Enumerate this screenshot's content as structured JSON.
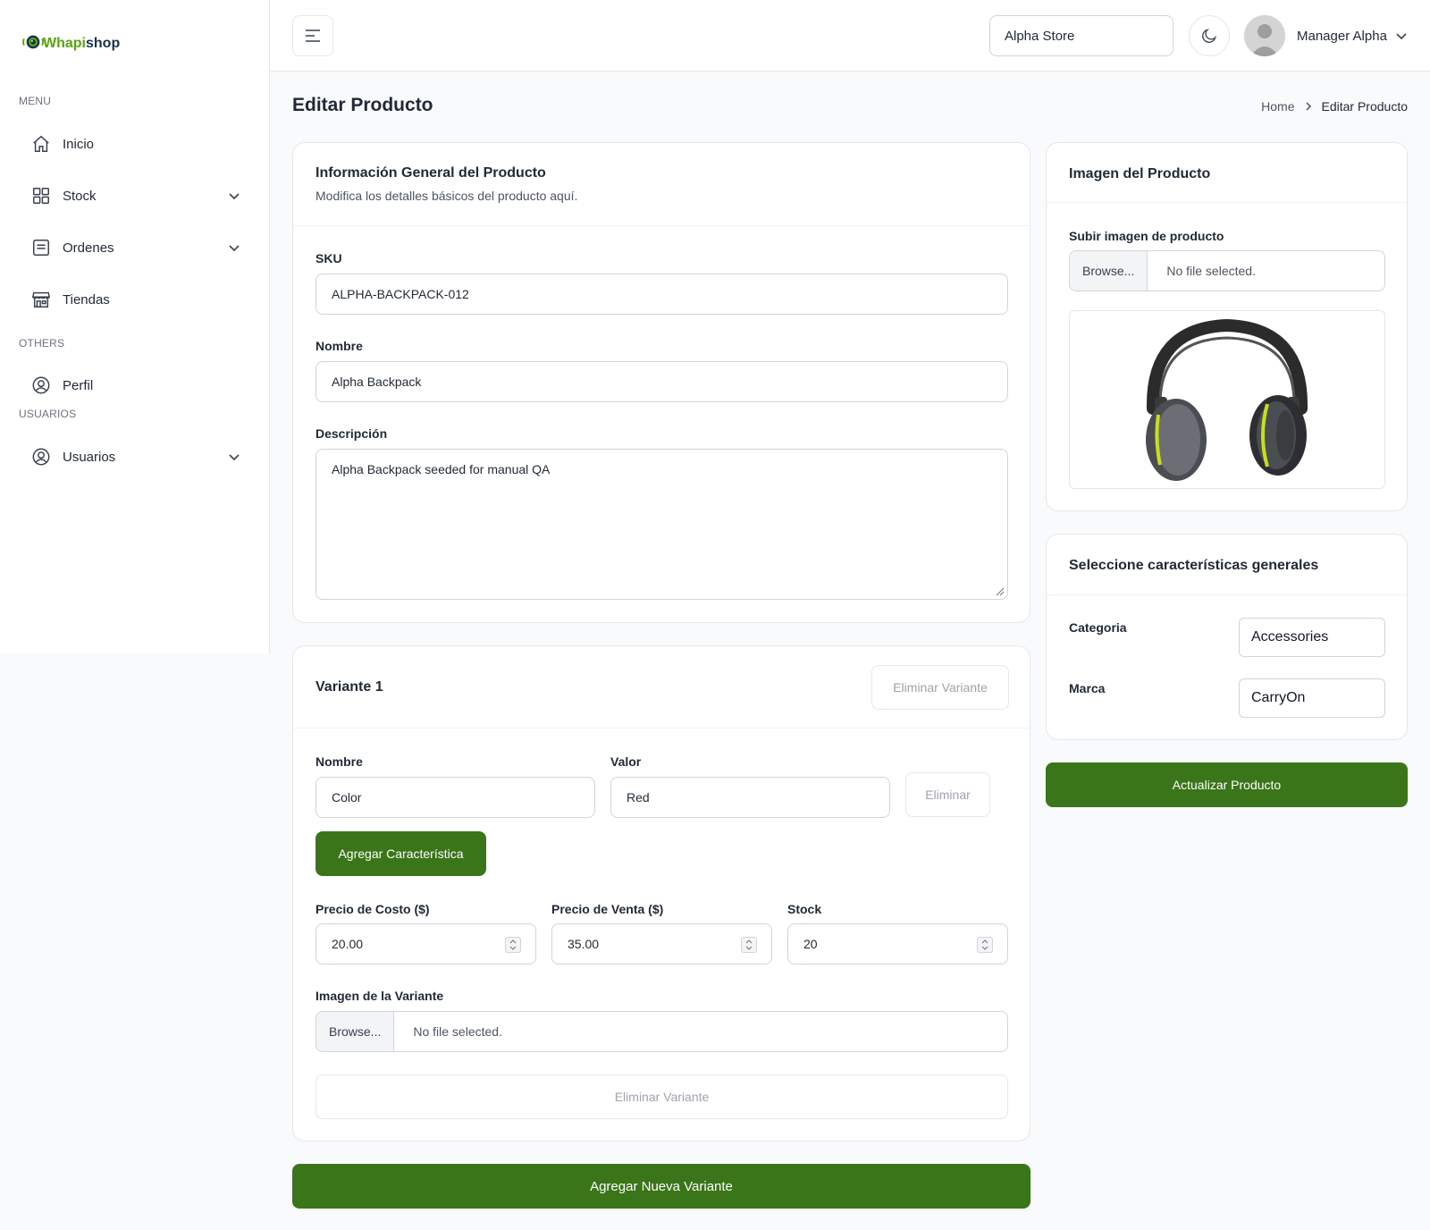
{
  "brand": {
    "logo_text_green": "Whapi",
    "logo_text_dark": "shop"
  },
  "sidebar": {
    "groups": {
      "menu": "MENU",
      "others": "OTHERS",
      "usuarios": "USUARIOS"
    },
    "items": [
      {
        "label": "Inicio",
        "icon": "home-icon"
      },
      {
        "label": "Stock",
        "icon": "grid-icon"
      },
      {
        "label": "Ordenes",
        "icon": "list-icon"
      },
      {
        "label": "Tiendas",
        "icon": "store-icon"
      },
      {
        "label": "Perfil",
        "icon": "user-circle-icon"
      },
      {
        "label": "Usuarios",
        "icon": "user-circle-icon"
      }
    ]
  },
  "header": {
    "store": "Alpha Store",
    "user_name": "Manager Alpha"
  },
  "page": {
    "title": "Editar Producto"
  },
  "breadcrumb": {
    "home": "Home",
    "current": "Editar Producto"
  },
  "general_info": {
    "title": "Información General del Producto",
    "subtitle": "Modifica los detalles básicos del producto aquí.",
    "sku_label": "SKU",
    "sku_value": "ALPHA-BACKPACK-012",
    "name_label": "Nombre",
    "name_value": "Alpha Backpack",
    "desc_label": "Descripción",
    "desc_value": "Alpha Backpack seeded for manual QA"
  },
  "variant": {
    "title": "Variante 1",
    "remove_top": "Eliminar Variante",
    "attr_name_label": "Nombre",
    "attr_value_label": "Valor",
    "attr_name": "Color",
    "attr_value": "Red",
    "attr_remove": "Eliminar",
    "add_attr": "Agregar Característica",
    "cost_label": "Precio de Costo ($)",
    "cost_value": "20.00",
    "sale_label": "Precio de Venta ($)",
    "sale_value": "35.00",
    "stock_label": "Stock",
    "stock_value": "20",
    "image_label": "Imagen de la Variante",
    "browse": "Browse...",
    "no_file": "No file selected.",
    "remove_bottom": "Eliminar Variante"
  },
  "add_variant": "Agregar Nueva Variante",
  "image_card": {
    "title": "Imagen del Producto",
    "upload_label": "Subir imagen de producto",
    "browse": "Browse...",
    "no_file": "No file selected."
  },
  "features": {
    "title": "Seleccione características generales",
    "category_label": "Categoria",
    "category_value": "Accessories",
    "brand_label": "Marca",
    "brand_value": "CarryOn"
  },
  "update_button": "Actualizar Producto",
  "colors": {
    "primary_green": "#3a751a",
    "logo_green": "#56a70f",
    "logo_dark": "#17324d"
  }
}
